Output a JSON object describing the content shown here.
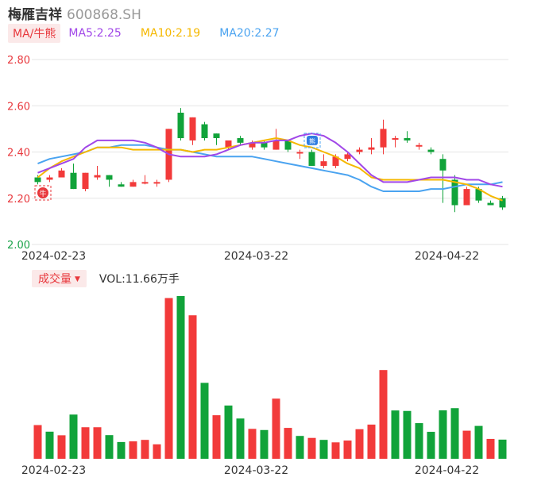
{
  "header": {
    "name": "梅雁吉祥",
    "code": "600868.SH"
  },
  "legend": {
    "ma_tag": "MA/牛熊",
    "ma5": "MA5:2.25",
    "ma10": "MA10:2.19",
    "ma20": "MA20:2.27"
  },
  "volume_legend": {
    "tag": "成交量",
    "text": "VOL:11.66万手"
  },
  "markers": {
    "buy": "牛",
    "signal": "熊"
  },
  "colors": {
    "up": "#f23a3a",
    "down": "#11a33a",
    "ma5": "#a147e8",
    "ma10": "#f5b800",
    "ma20": "#4aa3f0",
    "grid": "#e6e6e6"
  },
  "chart_data": [
    {
      "type": "candlestick",
      "title": "梅雁吉祥 600868.SH",
      "y_ticks": [
        "2.80",
        "2.60",
        "2.40",
        "2.20",
        "2.00"
      ],
      "ylim": [
        2.0,
        2.8
      ],
      "x_tick_labels": [
        "2024-02-23",
        "2024-03-22",
        "2024-04-22"
      ],
      "x_tick_index": [
        2,
        19,
        35
      ],
      "candles": [
        {
          "o": 2.29,
          "c": 2.27,
          "h": 2.3,
          "l": 2.26
        },
        {
          "o": 2.28,
          "c": 2.29,
          "h": 2.3,
          "l": 2.27
        },
        {
          "o": 2.29,
          "c": 2.32,
          "h": 2.33,
          "l": 2.29
        },
        {
          "o": 2.31,
          "c": 2.24,
          "h": 2.35,
          "l": 2.24
        },
        {
          "o": 2.24,
          "c": 2.31,
          "h": 2.31,
          "l": 2.23
        },
        {
          "o": 2.29,
          "c": 2.3,
          "h": 2.34,
          "l": 2.28
        },
        {
          "o": 2.3,
          "c": 2.28,
          "h": 2.3,
          "l": 2.25
        },
        {
          "o": 2.26,
          "c": 2.25,
          "h": 2.27,
          "l": 2.25
        },
        {
          "o": 2.25,
          "c": 2.27,
          "h": 2.28,
          "l": 2.25
        },
        {
          "o": 2.27,
          "c": 2.27,
          "h": 2.3,
          "l": 2.26
        },
        {
          "o": 2.27,
          "c": 2.27,
          "h": 2.28,
          "l": 2.25
        },
        {
          "o": 2.28,
          "c": 2.5,
          "h": 2.5,
          "l": 2.27
        },
        {
          "o": 2.57,
          "c": 2.46,
          "h": 2.59,
          "l": 2.45
        },
        {
          "o": 2.45,
          "c": 2.55,
          "h": 2.55,
          "l": 2.43
        },
        {
          "o": 2.52,
          "c": 2.46,
          "h": 2.53,
          "l": 2.45
        },
        {
          "o": 2.48,
          "c": 2.46,
          "h": 2.48,
          "l": 2.43
        },
        {
          "o": 2.42,
          "c": 2.45,
          "h": 2.45,
          "l": 2.41
        },
        {
          "o": 2.46,
          "c": 2.44,
          "h": 2.47,
          "l": 2.43
        },
        {
          "o": 2.42,
          "c": 2.44,
          "h": 2.45,
          "l": 2.41
        },
        {
          "o": 2.44,
          "c": 2.42,
          "h": 2.45,
          "l": 2.41
        },
        {
          "o": 2.41,
          "c": 2.45,
          "h": 2.5,
          "l": 2.41
        },
        {
          "o": 2.45,
          "c": 2.41,
          "h": 2.45,
          "l": 2.4
        },
        {
          "o": 2.4,
          "c": 2.4,
          "h": 2.41,
          "l": 2.37
        },
        {
          "o": 2.4,
          "c": 2.34,
          "h": 2.41,
          "l": 2.34
        },
        {
          "o": 2.34,
          "c": 2.36,
          "h": 2.39,
          "l": 2.33
        },
        {
          "o": 2.34,
          "c": 2.38,
          "h": 2.39,
          "l": 2.33
        },
        {
          "o": 2.37,
          "c": 2.39,
          "h": 2.4,
          "l": 2.36
        },
        {
          "o": 2.4,
          "c": 2.41,
          "h": 2.42,
          "l": 2.39
        },
        {
          "o": 2.41,
          "c": 2.42,
          "h": 2.46,
          "l": 2.39
        },
        {
          "o": 2.42,
          "c": 2.5,
          "h": 2.54,
          "l": 2.39
        },
        {
          "o": 2.46,
          "c": 2.46,
          "h": 2.47,
          "l": 2.42
        },
        {
          "o": 2.46,
          "c": 2.45,
          "h": 2.49,
          "l": 2.44
        },
        {
          "o": 2.43,
          "c": 2.43,
          "h": 2.44,
          "l": 2.41
        },
        {
          "o": 2.41,
          "c": 2.4,
          "h": 2.42,
          "l": 2.39
        },
        {
          "o": 2.37,
          "c": 2.32,
          "h": 2.39,
          "l": 2.18
        },
        {
          "o": 2.28,
          "c": 2.17,
          "h": 2.3,
          "l": 2.14
        },
        {
          "o": 2.17,
          "c": 2.24,
          "h": 2.25,
          "l": 2.17
        },
        {
          "o": 2.24,
          "c": 2.19,
          "h": 2.25,
          "l": 2.18
        },
        {
          "o": 2.18,
          "c": 2.17,
          "h": 2.19,
          "l": 2.17
        },
        {
          "o": 2.2,
          "c": 2.16,
          "h": 2.21,
          "l": 2.15
        }
      ],
      "ma5": [
        2.31,
        2.33,
        2.35,
        2.37,
        2.42,
        2.45,
        2.45,
        2.45,
        2.45,
        2.44,
        2.42,
        2.39,
        2.38,
        2.38,
        2.38,
        2.39,
        2.41,
        2.43,
        2.44,
        2.44,
        2.45,
        2.45,
        2.47,
        2.48,
        2.47,
        2.44,
        2.4,
        2.35,
        2.3,
        2.27,
        2.27,
        2.27,
        2.28,
        2.29,
        2.29,
        2.29,
        2.28,
        2.28,
        2.26,
        2.25
      ],
      "ma10": [
        2.29,
        2.33,
        2.36,
        2.38,
        2.4,
        2.42,
        2.42,
        2.42,
        2.41,
        2.41,
        2.41,
        2.41,
        2.41,
        2.4,
        2.41,
        2.41,
        2.42,
        2.43,
        2.44,
        2.45,
        2.46,
        2.45,
        2.43,
        2.42,
        2.4,
        2.38,
        2.35,
        2.33,
        2.29,
        2.28,
        2.28,
        2.28,
        2.28,
        2.28,
        2.28,
        2.27,
        2.26,
        2.24,
        2.21,
        2.19
      ],
      "ma20": [
        2.35,
        2.37,
        2.38,
        2.39,
        2.4,
        2.42,
        2.42,
        2.43,
        2.43,
        2.43,
        2.42,
        2.41,
        2.41,
        2.4,
        2.39,
        2.38,
        2.38,
        2.38,
        2.38,
        2.37,
        2.36,
        2.35,
        2.34,
        2.33,
        2.32,
        2.31,
        2.3,
        2.28,
        2.25,
        2.23,
        2.23,
        2.23,
        2.23,
        2.24,
        2.24,
        2.25,
        2.26,
        2.26,
        2.26,
        2.27
      ]
    },
    {
      "type": "bar",
      "title": "成交量",
      "unit": "万手",
      "last_value": 11.66,
      "x_tick_labels": [
        "2024-02-23",
        "2024-03-22",
        "2024-04-22"
      ],
      "values": [
        20.5,
        16.5,
        14.3,
        26.9,
        19.2,
        19.2,
        14.4,
        10.2,
        10.6,
        11.5,
        8.8,
        97.8,
        99.0,
        87.3,
        46.2,
        26.5,
        32.4,
        24.5,
        18.2,
        17.5,
        36.6,
        18.8,
        13.9,
        12.7,
        11.5,
        10.0,
        11.1,
        18.0,
        20.8,
        54.0,
        29.4,
        29.1,
        21.7,
        16.4,
        29.5,
        30.8,
        17.1,
        20.0,
        12.1,
        11.66
      ],
      "directions": [
        "up",
        "down",
        "up",
        "down",
        "up",
        "up",
        "down",
        "down",
        "up",
        "up",
        "up",
        "up",
        "down",
        "up",
        "down",
        "up",
        "down",
        "down",
        "up",
        "down",
        "up",
        "up",
        "down",
        "up",
        "down",
        "up",
        "up",
        "up",
        "up",
        "up",
        "down",
        "down",
        "down",
        "down",
        "down",
        "down",
        "up",
        "down",
        "up",
        "down"
      ]
    }
  ]
}
